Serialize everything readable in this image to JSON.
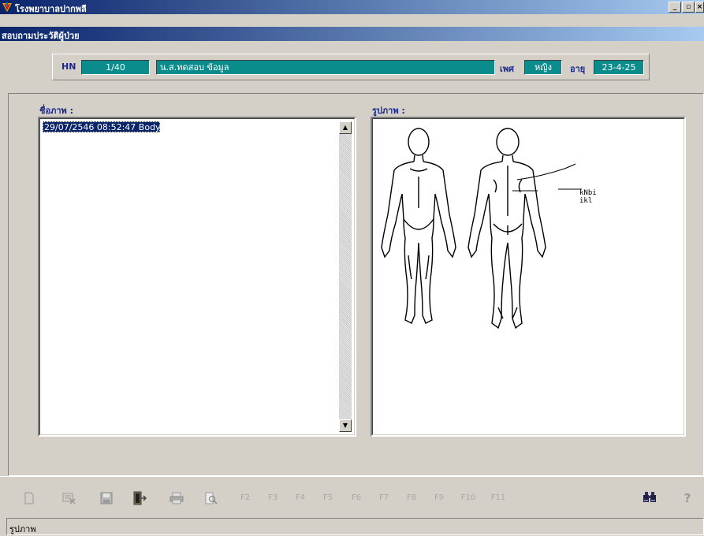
{
  "window": {
    "title": "โรงพยาบาลปากพลี",
    "minimize_label": "_",
    "maximize_label": "▫",
    "close_label": "×"
  },
  "form_title": "สอบถามประวัติผู้ป่วย",
  "patient": {
    "hn_label": "HN",
    "hn_value": "1/40",
    "name_value": "น.ส.ทดสอบ ข้อมูล",
    "sex_label": "เพศ",
    "sex_value": "หญิง",
    "age_label": "อายุ",
    "age_value": "23-4-25"
  },
  "image_list": {
    "label": "ชื่อภาพ  :",
    "items": [
      {
        "text": "29/07/2546 08:52:47 Body",
        "selected": true
      }
    ]
  },
  "image_view": {
    "label": "รูปภาพ  :",
    "annotation_line1": "kNbi",
    "annotation_line2": "ikl"
  },
  "toolbar": {
    "buttons": [
      {
        "name": "new-doc-icon",
        "label": ""
      },
      {
        "name": "delete-icon",
        "label": ""
      },
      {
        "name": "save-icon",
        "label": ""
      },
      {
        "name": "exit-door-icon",
        "label": ""
      },
      {
        "name": "print-icon",
        "label": ""
      },
      {
        "name": "print-preview-icon",
        "label": ""
      },
      {
        "name": "f2-button",
        "label": "F2"
      },
      {
        "name": "f3-button",
        "label": "F3"
      },
      {
        "name": "f4-button",
        "label": "F4"
      },
      {
        "name": "f5-button",
        "label": "F5"
      },
      {
        "name": "f6-button",
        "label": "F6"
      },
      {
        "name": "f7-button",
        "label": "F7"
      },
      {
        "name": "f8-button",
        "label": "F8"
      },
      {
        "name": "f9-button",
        "label": "F9"
      },
      {
        "name": "f10-button",
        "label": "F10"
      },
      {
        "name": "f11-button",
        "label": "F11"
      },
      {
        "name": "binoculars-icon",
        "label": ""
      },
      {
        "name": "help-icon",
        "label": "?"
      }
    ]
  },
  "status": {
    "text": "รูปภาพ"
  },
  "colors": {
    "titlebar": "#0a246a",
    "field_teal": "#0a8c8c",
    "label_blue": "#1d2a8c",
    "selection": "#0a246a"
  }
}
